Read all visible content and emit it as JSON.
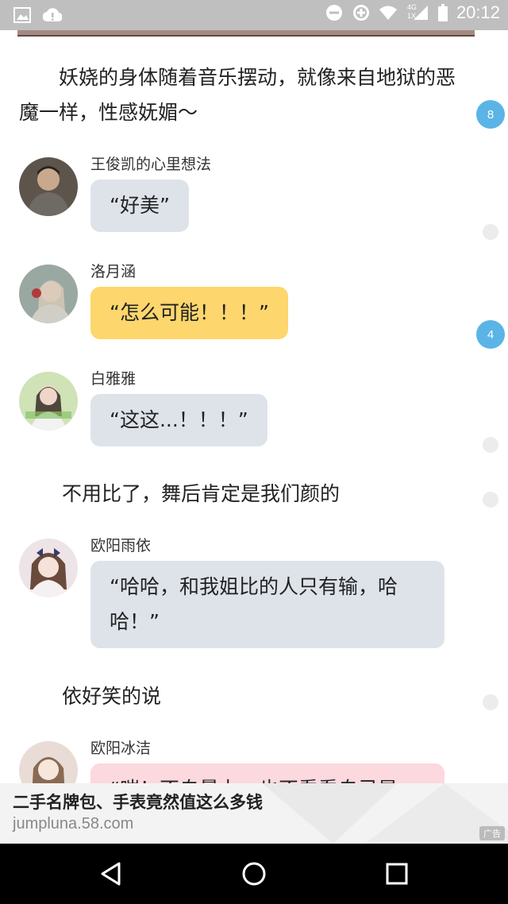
{
  "status_bar": {
    "time": "20:12",
    "network_label": "4G",
    "sim_label": "1X",
    "icons": [
      "gallery-icon",
      "alert-icon",
      "do-not-disturb-icon",
      "data-saver-icon",
      "wifi-icon",
      "signal-icon",
      "battery-icon"
    ]
  },
  "story": {
    "intro_paragraph": "妖娆的身体随着音乐摆动，就像来自地狱的恶魔一样，性感妩媚～",
    "messages": [
      {
        "nickname": "王俊凯的心里想法",
        "text": "“好美”",
        "style": "grey"
      },
      {
        "nickname": "洛月涵",
        "text": "“怎么可能！！！”",
        "style": "yellow"
      },
      {
        "nickname": "白雅雅",
        "text": "“这这...！！！”",
        "style": "grey"
      },
      {
        "nickname": "欧阳雨依",
        "text": "“哈哈，和我姐比的人只有输，哈哈！”",
        "style": "grey"
      },
      {
        "nickname": "欧阳冰洁",
        "text": "“嗤！不自量力，也不看看自己是",
        "style": "pink"
      }
    ],
    "narrations": [
      "不用比了，舞后肯定是我们颜的",
      "依好笑的说"
    ]
  },
  "side_comments": {
    "badges": [
      "8",
      "4"
    ]
  },
  "ad": {
    "title": "二手名牌包、手表竟然值这么多钱",
    "url": "jumpluna.58.com",
    "tag": "广告"
  },
  "colors": {
    "bubble_grey": "#dee3ea",
    "bubble_yellow": "#fdd66d",
    "bubble_pink": "#fcd8df",
    "badge_blue": "#5ab4e6"
  }
}
